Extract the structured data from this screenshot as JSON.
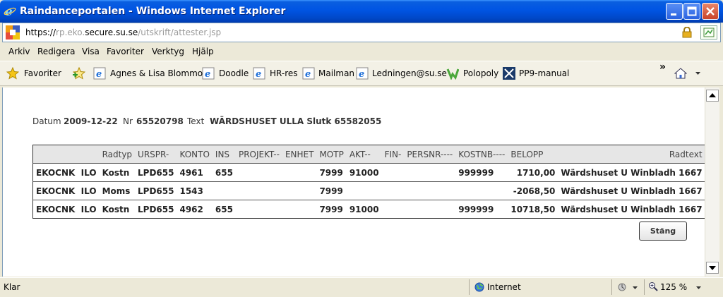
{
  "window": {
    "title": "Raindanceportalen - Windows Internet Explorer"
  },
  "address": {
    "scheme": "https://",
    "host_pre": "rp.eko.",
    "host_main": "secure.su.se",
    "path": "/utskrift/attester.jsp"
  },
  "menu": {
    "items": [
      "Arkiv",
      "Redigera",
      "Visa",
      "Favoriter",
      "Verktyg",
      "Hjälp"
    ]
  },
  "favorites": {
    "label": "Favoriter",
    "links": [
      "Agnes & Lisa Blommor",
      "Doodle",
      "HR-res",
      "Mailman",
      "Ledningen@su.se",
      "Polopoly",
      "PP9-manual"
    ],
    "overflow": "»"
  },
  "record": {
    "datum_label": "Datum",
    "datum_value": "2009-12-22",
    "nr_label": "Nr",
    "nr_value": "65520798",
    "text_label": "Text",
    "text_value": "WÄRDSHUSET ULLA Slutk 65582055"
  },
  "table": {
    "headers": [
      "",
      "Radtyp",
      "URSPR-",
      "KONTO",
      "INS",
      "PROJEKT--",
      "ENHET",
      "MOTP",
      "AKT--",
      "FIN-",
      "PERSNR----",
      "KOSTNB----",
      "BELOPP",
      "Radtext"
    ],
    "rows": [
      [
        "EKOCNK",
        "ILO",
        "Kostn",
        "LPD655",
        "4961",
        "655",
        "",
        "",
        "7999",
        "91000",
        "",
        "",
        "999999",
        "1710,00",
        "Wärdshuset U Winbladh 1667"
      ],
      [
        "EKOCNK",
        "ILO",
        "Moms",
        "LPD655",
        "1543",
        "",
        "",
        "",
        "7999",
        "",
        "",
        "",
        "",
        "-2068,50",
        "Wärdshuset U Winbladh 1667"
      ],
      [
        "EKOCNK",
        "ILO",
        "Kostn",
        "LPD655",
        "4962",
        "655",
        "",
        "",
        "7999",
        "91000",
        "",
        "",
        "999999",
        "10718,50",
        "Wärdshuset U Winbladh 1667"
      ]
    ]
  },
  "buttons": {
    "close_label": "Stäng"
  },
  "status": {
    "text": "Klar",
    "zone": "Internet",
    "zoom": "125 %"
  }
}
